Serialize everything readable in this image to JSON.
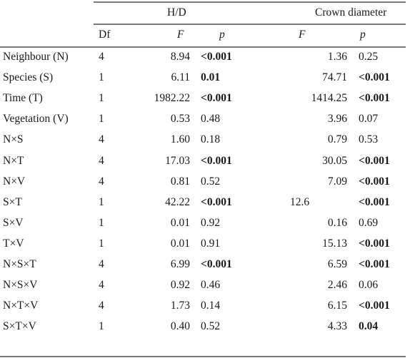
{
  "table": {
    "group_headers": {
      "hd": "H/D",
      "crown": "Crown diameter"
    },
    "column_headers": {
      "df": "Df",
      "hd_f": "F",
      "hd_p": "p",
      "crown_f": "F",
      "crown_p": "p"
    },
    "rows": [
      {
        "effect": "Neighbour (N)",
        "df": "4",
        "hd_f": "8.94",
        "hd_p": "<0.001",
        "hd_p_sig": true,
        "crown_f": "1.36",
        "crown_p": "0.25",
        "crown_p_sig": false
      },
      {
        "effect": "Species (S)",
        "df": "1",
        "hd_f": "6.11",
        "hd_p": "0.01",
        "hd_p_sig": true,
        "crown_f": "74.71",
        "crown_p": "<0.001",
        "crown_p_sig": true
      },
      {
        "effect": "Time (T)",
        "df": "1",
        "hd_f": "1982.22",
        "hd_p": "<0.001",
        "hd_p_sig": true,
        "crown_f": "1414.25",
        "crown_p": "<0.001",
        "crown_p_sig": true
      },
      {
        "effect": "Vegetation (V)",
        "df": "1",
        "hd_f": "0.53",
        "hd_p": "0.48",
        "hd_p_sig": false,
        "crown_f": "3.96",
        "crown_p": "0.07",
        "crown_p_sig": false
      },
      {
        "effect": "N×S",
        "df": "4",
        "hd_f": "1.60",
        "hd_p": "0.18",
        "hd_p_sig": false,
        "crown_f": "0.79",
        "crown_p": "0.53",
        "crown_p_sig": false
      },
      {
        "effect": "N×T",
        "df": "4",
        "hd_f": "17.03",
        "hd_p": "<0.001",
        "hd_p_sig": true,
        "crown_f": "30.05",
        "crown_p": "<0.001",
        "crown_p_sig": true
      },
      {
        "effect": "N×V",
        "df": "4",
        "hd_f": "0.81",
        "hd_p": "0.52",
        "hd_p_sig": false,
        "crown_f": "7.09",
        "crown_p": "<0.001",
        "crown_p_sig": true
      },
      {
        "effect": "S×T",
        "df": "1",
        "hd_f": "42.22",
        "hd_p": "<0.001",
        "hd_p_sig": true,
        "crown_f": "12.6",
        "crown_p": "<0.001",
        "crown_p_sig": true
      },
      {
        "effect": "S×V",
        "df": "1",
        "hd_f": "0.01",
        "hd_p": "0.92",
        "hd_p_sig": false,
        "crown_f": "0.16",
        "crown_p": "0.69",
        "crown_p_sig": false
      },
      {
        "effect": "T×V",
        "df": "1",
        "hd_f": "0.01",
        "hd_p": "0.91",
        "hd_p_sig": false,
        "crown_f": "15.13",
        "crown_p": "<0.001",
        "crown_p_sig": true
      },
      {
        "effect": "N×S×T",
        "df": "4",
        "hd_f": "6.99",
        "hd_p": "<0.001",
        "hd_p_sig": true,
        "crown_f": "6.59",
        "crown_p": "<0.001",
        "crown_p_sig": true
      },
      {
        "effect": "N×S×V",
        "df": "4",
        "hd_f": "0.92",
        "hd_p": "0.46",
        "hd_p_sig": false,
        "crown_f": "2.46",
        "crown_p": "0.06",
        "crown_p_sig": false
      },
      {
        "effect": "N×T×V",
        "df": "4",
        "hd_f": "1.73",
        "hd_p": "0.14",
        "hd_p_sig": false,
        "crown_f": "6.15",
        "crown_p": "<0.001",
        "crown_p_sig": true
      },
      {
        "effect": "S×T×V",
        "df": "1",
        "hd_f": "0.40",
        "hd_p": "0.52",
        "hd_p_sig": false,
        "crown_f": "4.33",
        "crown_p": "0.04",
        "crown_p_sig": true
      }
    ]
  }
}
